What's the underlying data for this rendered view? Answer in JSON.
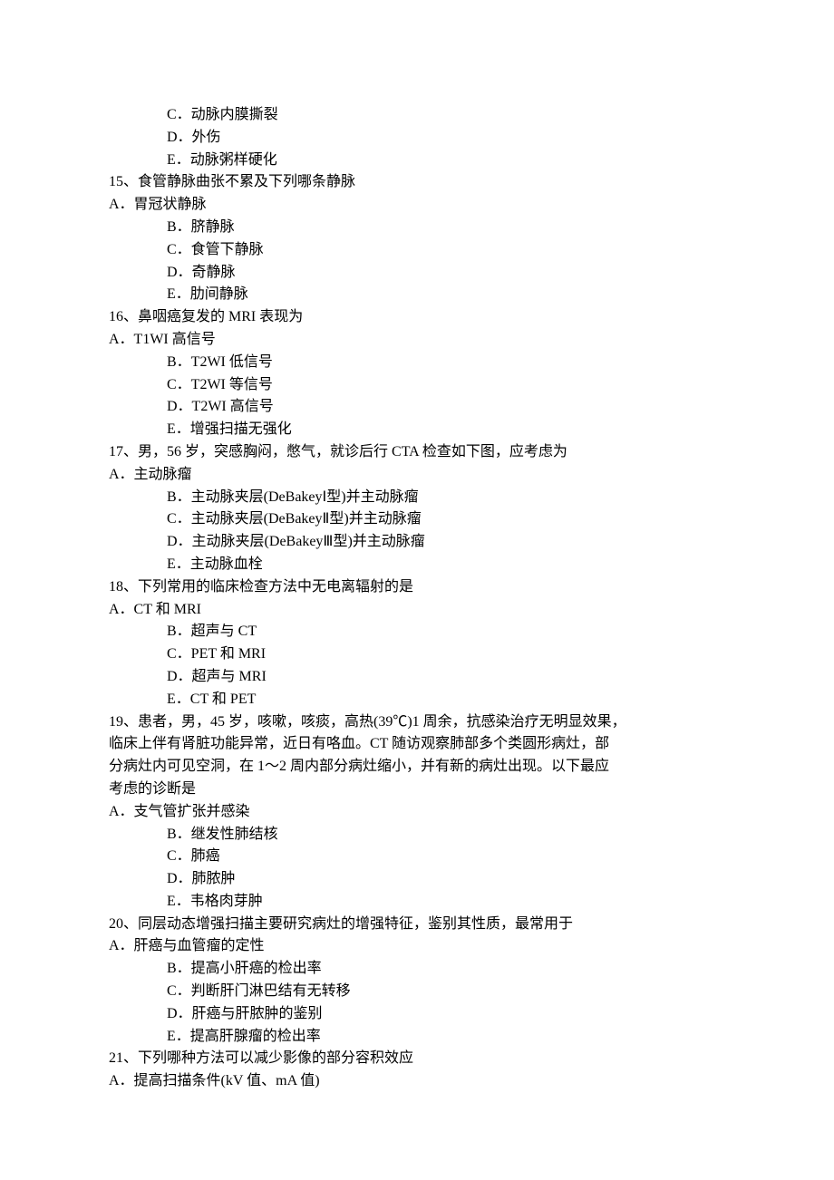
{
  "questions": [
    {
      "number": "",
      "stem": [],
      "leadOptions": [
        "C．动脉内膜撕裂",
        "D．外伤",
        "E．动脉粥样硬化"
      ]
    },
    {
      "number": "15、",
      "stem": [
        "食管静脉曲张不累及下列哪条静脉"
      ],
      "firstOption": "A．胃冠状静脉",
      "options": [
        "B．脐静脉",
        "C．食管下静脉",
        "D．奇静脉",
        "E．肋间静脉"
      ]
    },
    {
      "number": "16、",
      "stem": [
        "鼻咽癌复发的 MRI 表现为"
      ],
      "firstOption": "A．T1WI 高信号",
      "options": [
        "B．T2WI 低信号",
        "C．T2WI 等信号",
        "D．T2WI 高信号",
        "E．增强扫描无强化"
      ]
    },
    {
      "number": "17、",
      "stem": [
        "男，56 岁，突感胸闷，憋气，就诊后行 CTA 检查如下图，应考虑为"
      ],
      "firstOption": "A．主动脉瘤",
      "options": [
        "B．主动脉夹层(DeBakeyⅠ型)并主动脉瘤",
        "C．主动脉夹层(DeBakeyⅡ型)并主动脉瘤",
        "D．主动脉夹层(DeBakeyⅢ型)并主动脉瘤",
        "E．主动脉血栓"
      ]
    },
    {
      "number": "18、",
      "stem": [
        "下列常用的临床检查方法中无电离辐射的是"
      ],
      "firstOption": "A．CT 和 MRI",
      "options": [
        "B．超声与 CT",
        "C．PET 和 MRI",
        "D．超声与 MRI",
        "E．CT 和 PET"
      ]
    },
    {
      "number": "19、",
      "stem": [
        "患者，男，45 岁，咳嗽，咳痰，高热(39℃)1 周余，抗感染治疗无明显效果，",
        "临床上伴有肾脏功能异常，近日有咯血。CT 随访观察肺部多个类圆形病灶，部",
        "分病灶内可见空洞，在 1～2 周内部分病灶缩小，并有新的病灶出现。以下最应",
        "考虑的诊断是"
      ],
      "firstOption": "A．支气管扩张并感染",
      "options": [
        "B．继发性肺结核",
        "C．肺癌",
        "D．肺脓肿",
        "E．韦格肉芽肿"
      ]
    },
    {
      "number": "20、",
      "stem": [
        "同层动态增强扫描主要研究病灶的增强特征，鉴别其性质，最常用于"
      ],
      "firstOption": "A．肝癌与血管瘤的定性",
      "options": [
        "B．提高小肝癌的检出率",
        "C．判断肝门淋巴结有无转移",
        "D．肝癌与肝脓肿的鉴别",
        "E．提高肝腺瘤的检出率"
      ]
    },
    {
      "number": "21、",
      "stem": [
        "下列哪种方法可以减少影像的部分容积效应"
      ],
      "firstOption": "A．提高扫描条件(kV 值、mA 值)",
      "options": []
    }
  ]
}
